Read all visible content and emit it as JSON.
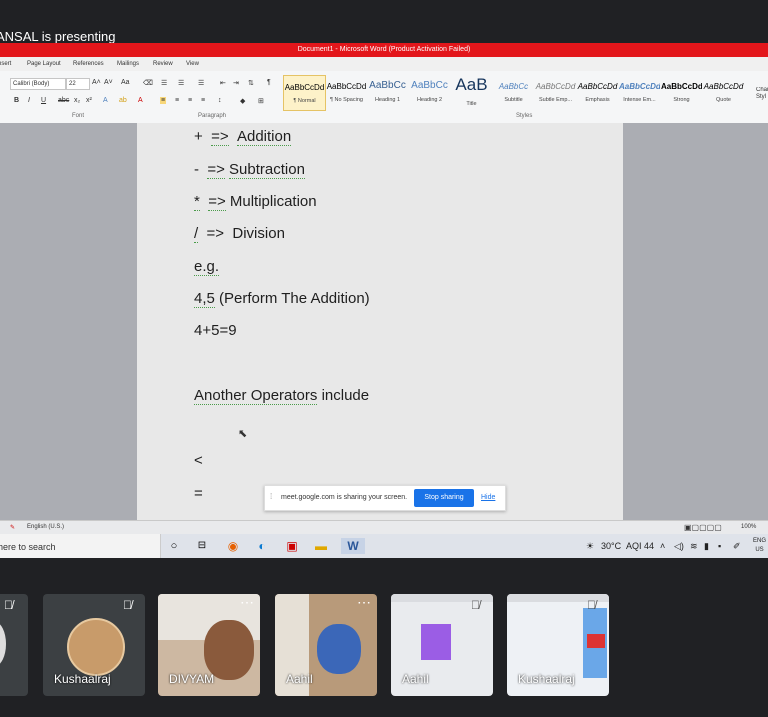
{
  "presenter": {
    "text": "ANSAL is presenting"
  },
  "word": {
    "title": "Document1 - Microsoft Word (Product Activation Failed)",
    "tabs": [
      "nsert",
      "Page Layout",
      "References",
      "Mailings",
      "Review",
      "View"
    ],
    "font_name": "Calibri (Body)",
    "font_size": "22",
    "groups": [
      "Font",
      "Paragraph",
      "Styles"
    ],
    "styles": [
      {
        "sample": "AaBbCcDd",
        "name": "¶ Normal"
      },
      {
        "sample": "AaBbCcDd",
        "name": "¶ No Spacing"
      },
      {
        "sample": "AaBbCc",
        "name": "Heading 1"
      },
      {
        "sample": "AaBbCc",
        "name": "Heading 2"
      },
      {
        "sample": "AaB",
        "name": "Title"
      },
      {
        "sample": "AaBbCc",
        "name": "Subtitle"
      },
      {
        "sample": "AaBbCcDd",
        "name": "Subtle Emp..."
      },
      {
        "sample": "AaBbCcDd",
        "name": "Emphasis"
      },
      {
        "sample": "AaBbCcDd",
        "name": "Intense Em..."
      },
      {
        "sample": "AaBbCcDd",
        "name": "Strong"
      },
      {
        "sample": "AaBbCcDd",
        "name": "Quote"
      }
    ],
    "change_styles": "Char Styl",
    "status_language": "English (U.S.)",
    "zoom": "100%"
  },
  "document": {
    "lines": [
      {
        "a": "+",
        "b": "=>",
        "c": "Addition"
      },
      {
        "a": "-",
        "b": "=>",
        "c": "Subtraction"
      },
      {
        "a": "*",
        "b": "=>",
        "c": "Multiplication"
      },
      {
        "a": "/",
        "b": "=>",
        "c": "Division"
      }
    ],
    "eg": "e.g.",
    "example_input": "4,5",
    "example_note": "(Perform The Addition)",
    "example_result": "4+5=9",
    "another_a": "Another Operators",
    "another_b": "include",
    "lt": "<",
    "eq": "="
  },
  "share_bar": {
    "text": "meet.google.com is sharing your screen.",
    "stop_label": "Stop sharing",
    "hide_label": "Hide"
  },
  "taskbar": {
    "search_placeholder": "here to search",
    "temperature": "30°C",
    "aqi": "AQI 44",
    "lang_top": "ENG",
    "lang_bottom": "US"
  },
  "participants": [
    {
      "name": "Kushaalraj"
    },
    {
      "name": "DIVYAM"
    },
    {
      "name": "Aahil"
    },
    {
      "name": "Aahil"
    },
    {
      "name": "Kushaalraj"
    }
  ],
  "colors": {
    "title_bar": "#e3161b",
    "meet_bg": "#202124",
    "stop_button": "#1a73e8"
  }
}
